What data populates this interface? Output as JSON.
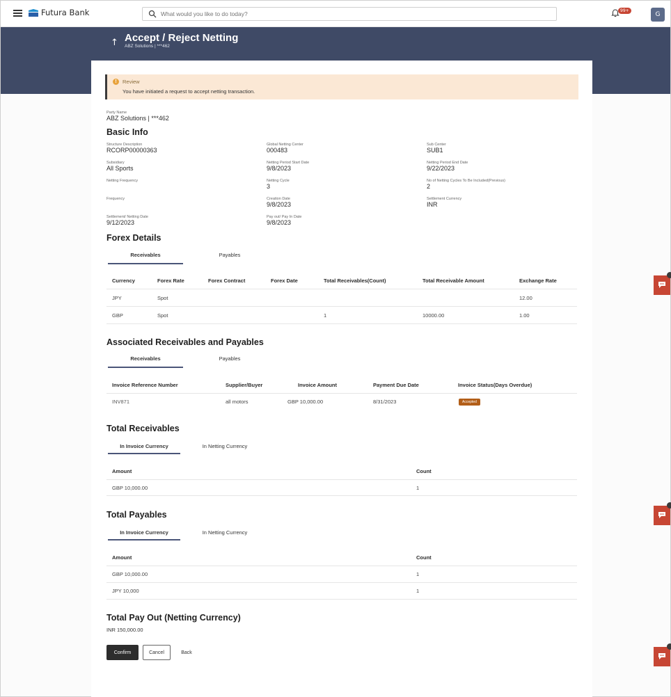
{
  "app": {
    "brand": "Futura Bank",
    "avatar_initial": "G",
    "notifications_badge": "99+"
  },
  "search": {
    "placeholder": "What would you like to do today?"
  },
  "header": {
    "title": "Accept / Reject Netting",
    "subtitle": "ABZ Solutions | ***462"
  },
  "review": {
    "heading": "Review",
    "message": "You have initiated a request to accept netting transaction."
  },
  "party": {
    "label": "Party Name",
    "value": "ABZ Solutions | ***462"
  },
  "basic_info": {
    "title": "Basic Info",
    "fields": [
      {
        "label": "Structure Description",
        "value": "RCORP00000363"
      },
      {
        "label": "Global Netting Center",
        "value": "000483"
      },
      {
        "label": "Sub Center",
        "value": "SUB1"
      },
      {
        "label": "Subsidiary",
        "value": "All Sports"
      },
      {
        "label": "Netting Period Start Date",
        "value": "9/8/2023"
      },
      {
        "label": "Netting Period End Date",
        "value": "9/22/2023"
      },
      {
        "label": "Netting Frequency",
        "value": ""
      },
      {
        "label": "Netting Cycle",
        "value": "3"
      },
      {
        "label": "No of Netting Cycles To Be Included(Previous)",
        "value": "2"
      },
      {
        "label": "Frequency",
        "value": ""
      },
      {
        "label": "Creation Date",
        "value": "9/8/2023"
      },
      {
        "label": "Settlement Currency",
        "value": "INR"
      },
      {
        "label": "Settlement/ Netting Date",
        "value": "9/12/2023"
      },
      {
        "label": "Pay out/ Pay In Date",
        "value": "9/8/2023"
      }
    ]
  },
  "forex": {
    "title": "Forex Details",
    "tabs": [
      "Receivables",
      "Payables"
    ],
    "columns": [
      "Currency",
      "Forex Rate",
      "Forex Contract",
      "Forex Date",
      "Total Receivables(Count)",
      "Total Receivable Amount",
      "Exchange Rate"
    ],
    "rows": [
      [
        "JPY",
        "Spot",
        "",
        "",
        "",
        "",
        "12.00"
      ],
      [
        "GBP",
        "Spot",
        "",
        "",
        "1",
        "10000.00",
        "1.00"
      ]
    ]
  },
  "associated": {
    "title": "Associated Receivables and Payables",
    "tabs": [
      "Receivables",
      "Payables"
    ],
    "columns": [
      "Invoice Reference Number",
      "Supplier/Buyer",
      "Invoice Amount",
      "Payment Due Date",
      "Invoice Status(Days Overdue)"
    ],
    "rows": [
      [
        "INV871",
        "all motors",
        "GBP 10,000.00",
        "8/31/2023",
        "Accepted"
      ]
    ]
  },
  "total_receivables": {
    "title": "Total Receivables",
    "tabs": [
      "In Invoice Currency",
      "In Netting Currency"
    ],
    "columns": [
      "Amount",
      "Count"
    ],
    "rows": [
      [
        "GBP 10,000.00",
        "1"
      ]
    ]
  },
  "total_payables": {
    "title": "Total Payables",
    "tabs": [
      "In Invoice Currency",
      "In Netting Currency"
    ],
    "columns": [
      "Amount",
      "Count"
    ],
    "rows": [
      [
        "GBP 10,000.00",
        "1"
      ],
      [
        "JPY 10,000",
        "1"
      ]
    ]
  },
  "total_payout": {
    "title": "Total Pay Out (Netting Currency)",
    "value": "INR 150,000.00"
  },
  "actions": {
    "confirm": "Confirm",
    "cancel": "Cancel",
    "back": "Back"
  },
  "colors": {
    "header_band": "#3f4a66",
    "review_bg": "#fbe8d5",
    "accent_red": "#c74634",
    "status_accepted": "#b25e18",
    "primary_button": "#2d2d2d"
  }
}
